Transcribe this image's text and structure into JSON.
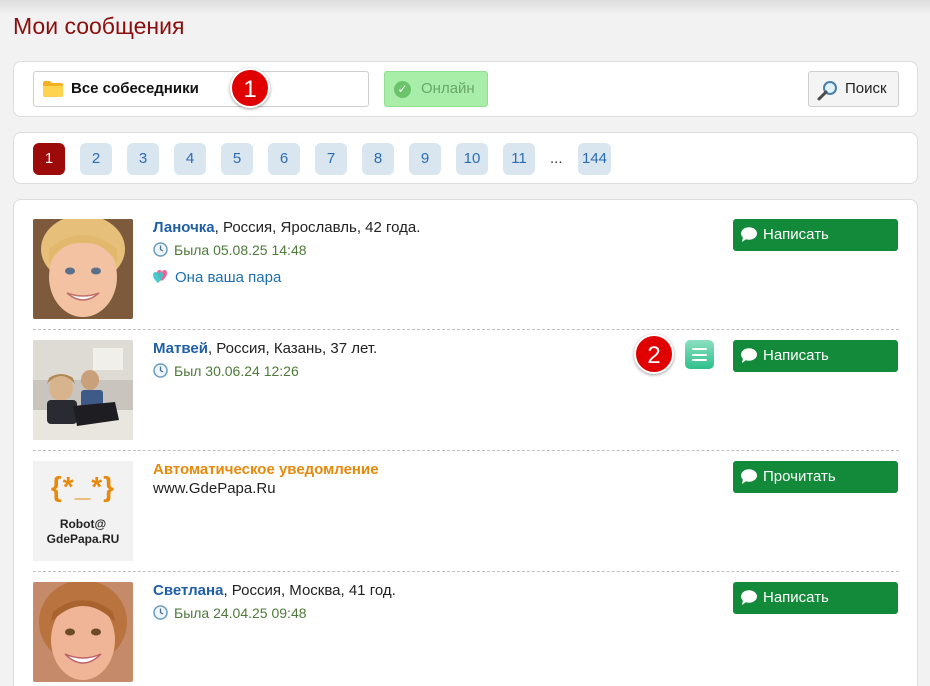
{
  "page_title": "Мои сообщения",
  "filter": {
    "select_label": "Все собеседники",
    "online_label": "Онлайн",
    "search_label": "Поиск",
    "marker": "1"
  },
  "pagination": {
    "pages": [
      "1",
      "2",
      "3",
      "4",
      "5",
      "6",
      "7",
      "8",
      "9",
      "10",
      "11"
    ],
    "ellipsis": "...",
    "last": "144",
    "active": "1"
  },
  "conversations": [
    {
      "name": "Ланочка",
      "details": ", Россия, Ярославль, 42 года.",
      "last_seen": "Была 05.08.25 14:48",
      "pair": "Она ваша пара",
      "action": "Написать"
    },
    {
      "name": "Матвей",
      "details": ", Россия, Казань, 37 лет.",
      "last_seen": "Был 30.06.24 12:26",
      "marker": "2",
      "action": "Написать"
    },
    {
      "title": "Автоматическое уведомление",
      "subtitle": "www.GdePapa.Ru",
      "avatar_face": "{*_*}",
      "avatar_line1": "Robot@",
      "avatar_line2": "GdePapa.RU",
      "action": "Прочитать"
    },
    {
      "name": "Светлана",
      "details": ", Россия, Москва, 41 год.",
      "last_seen": "Была 24.04.25 09:48",
      "action": "Написать"
    }
  ],
  "colors": {
    "title": "#8b0d0d",
    "accent_green": "#128a3a",
    "link_blue": "#1f5fa8",
    "active_page": "#9c0a0a",
    "robot_orange": "#e58a0c"
  }
}
